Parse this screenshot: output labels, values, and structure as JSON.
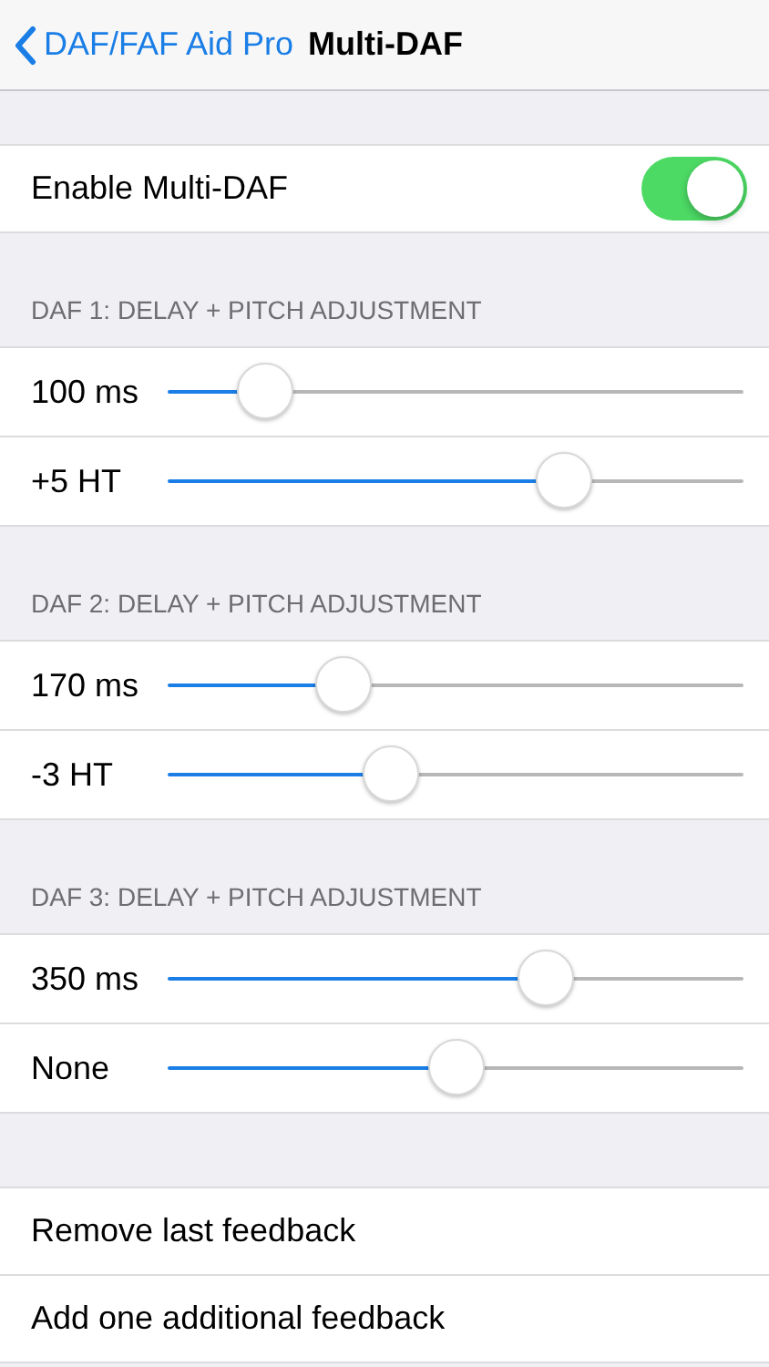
{
  "nav": {
    "back_label": "DAF/FAF Aid Pro",
    "title": "Multi-DAF"
  },
  "enable": {
    "label": "Enable Multi-DAF",
    "on": true
  },
  "sections": [
    {
      "header": "DAF 1: DELAY + PITCH ADJUSTMENT",
      "sliders": [
        {
          "reading": "100 ms",
          "level": 0.168
        },
        {
          "reading": "+5 HT",
          "level": 0.687
        }
      ]
    },
    {
      "header": "DAF 2: DELAY + PITCH ADJUSTMENT",
      "sliders": [
        {
          "reading": "170 ms",
          "level": 0.304
        },
        {
          "reading": "-3 HT",
          "level": 0.386
        }
      ]
    },
    {
      "header": "DAF 3: DELAY + PITCH ADJUSTMENT",
      "sliders": [
        {
          "reading": "350 ms",
          "level": 0.655
        },
        {
          "reading": "None",
          "level": 0.5
        }
      ]
    }
  ],
  "actions": [
    "Remove last feedback",
    "Add one additional feedback"
  ]
}
